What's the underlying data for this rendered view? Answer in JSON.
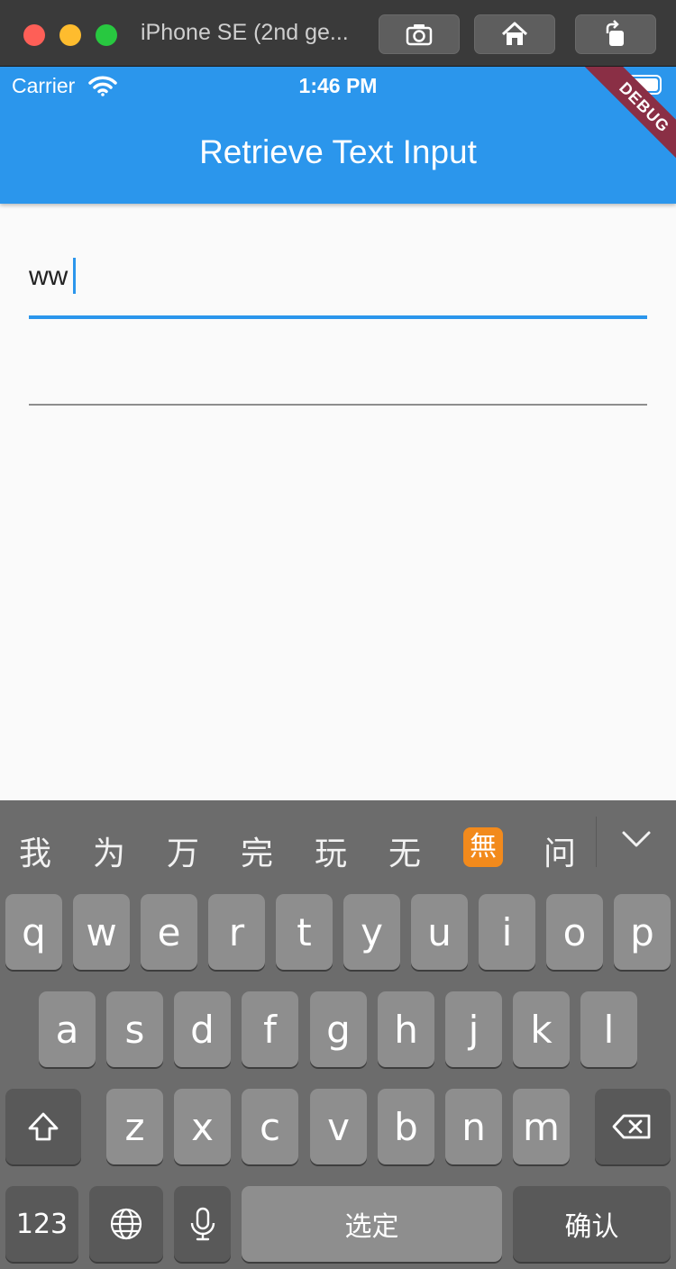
{
  "window": {
    "title": "iPhone SE (2nd ge..."
  },
  "status_bar": {
    "carrier": "Carrier",
    "time": "1:46 PM"
  },
  "app_bar": {
    "title": "Retrieve Text Input",
    "debug_banner": "DEBUG",
    "color": "#2b96ec"
  },
  "form": {
    "field1_value": "ww",
    "field2_value": ""
  },
  "keyboard": {
    "candidates": [
      "我",
      "为",
      "万",
      "完",
      "玩",
      "无",
      "🈚",
      "问"
    ],
    "row1": [
      "q",
      "w",
      "e",
      "r",
      "t",
      "y",
      "u",
      "i",
      "o",
      "p"
    ],
    "row2": [
      "a",
      "s",
      "d",
      "f",
      "g",
      "h",
      "j",
      "k",
      "l"
    ],
    "row3": [
      "z",
      "x",
      "c",
      "v",
      "b",
      "n",
      "m"
    ],
    "numbers_label": "123",
    "space_label": "选定",
    "confirm_label": "确认"
  }
}
